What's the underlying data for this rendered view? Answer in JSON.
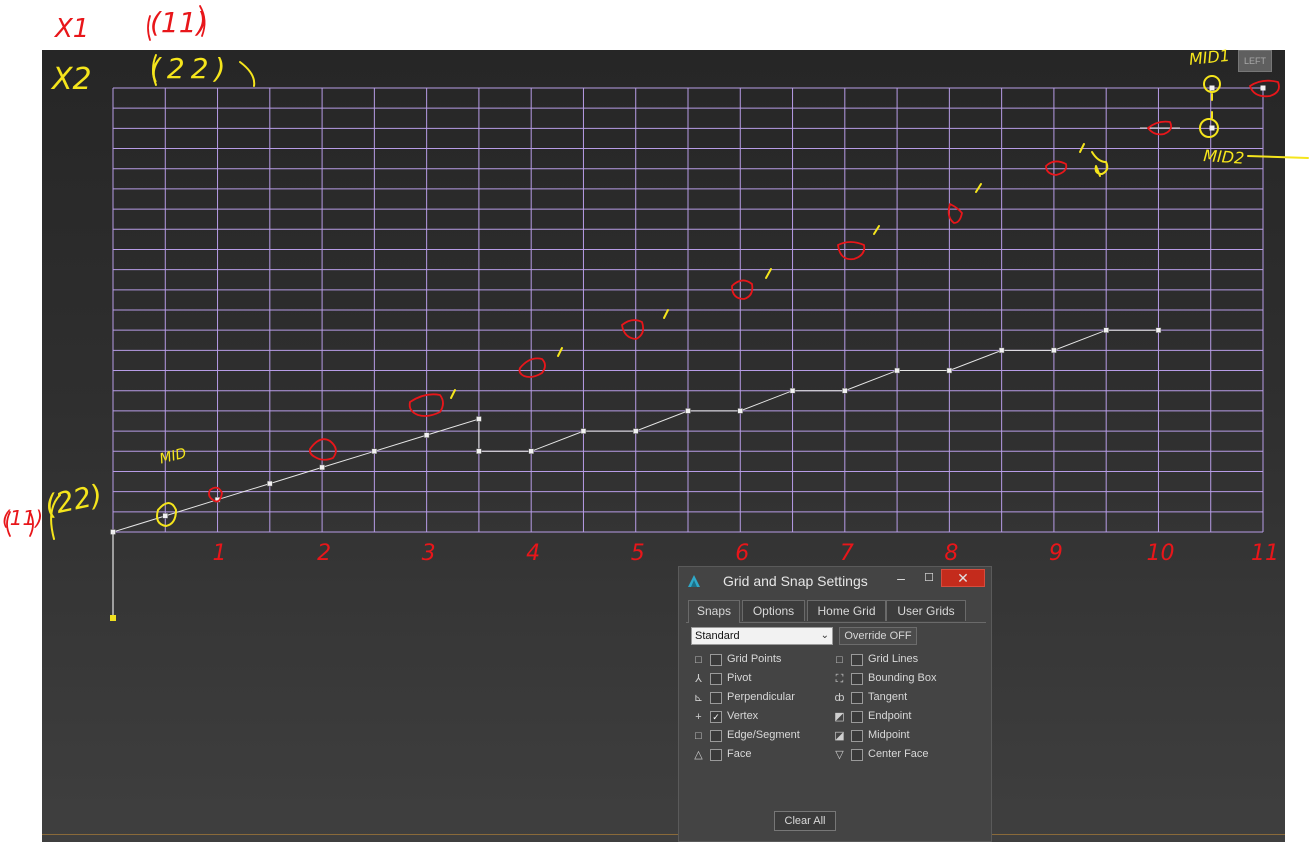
{
  "viewport": {
    "view_cube_label": "LEFT"
  },
  "grid": {
    "columns": 22,
    "rows": 22,
    "line_color": "#b79ce6",
    "x_tick_labels": [
      "1",
      "2",
      "3",
      "4",
      "5",
      "6",
      "7",
      "8",
      "9",
      "10",
      "11"
    ]
  },
  "annotations": {
    "x1": "X1",
    "x2": "X2",
    "count_11_top": "(11)",
    "count_22_top": "(22)",
    "count_11_left": "(11)",
    "count_22_left": "(22)",
    "mid_left": "MID",
    "mid_1": "MID1",
    "mid_2": "MID2"
  },
  "dialog": {
    "title": "Grid and Snap Settings",
    "tabs": [
      "Snaps",
      "Options",
      "Home Grid",
      "User Grids"
    ],
    "active_tab": "Snaps",
    "preset": "Standard",
    "override_label": "Override OFF",
    "clear_all_label": "Clear All",
    "snaps_left": [
      {
        "label": "Grid Points",
        "checked": false,
        "icon": "grid-points-icon"
      },
      {
        "label": "Pivot",
        "checked": false,
        "icon": "pivot-icon"
      },
      {
        "label": "Perpendicular",
        "checked": false,
        "icon": "perpendicular-icon"
      },
      {
        "label": "Vertex",
        "checked": true,
        "icon": "vertex-icon"
      },
      {
        "label": "Edge/Segment",
        "checked": false,
        "icon": "edge-segment-icon"
      },
      {
        "label": "Face",
        "checked": false,
        "icon": "face-icon"
      }
    ],
    "snaps_right": [
      {
        "label": "Grid Lines",
        "checked": false,
        "icon": "grid-lines-icon"
      },
      {
        "label": "Bounding Box",
        "checked": false,
        "icon": "bounding-box-icon"
      },
      {
        "label": "Tangent",
        "checked": false,
        "icon": "tangent-icon"
      },
      {
        "label": "Endpoint",
        "checked": false,
        "icon": "endpoint-icon"
      },
      {
        "label": "Midpoint",
        "checked": false,
        "icon": "midpoint-icon"
      },
      {
        "label": "Center Face",
        "checked": false,
        "icon": "center-face-icon"
      }
    ]
  }
}
